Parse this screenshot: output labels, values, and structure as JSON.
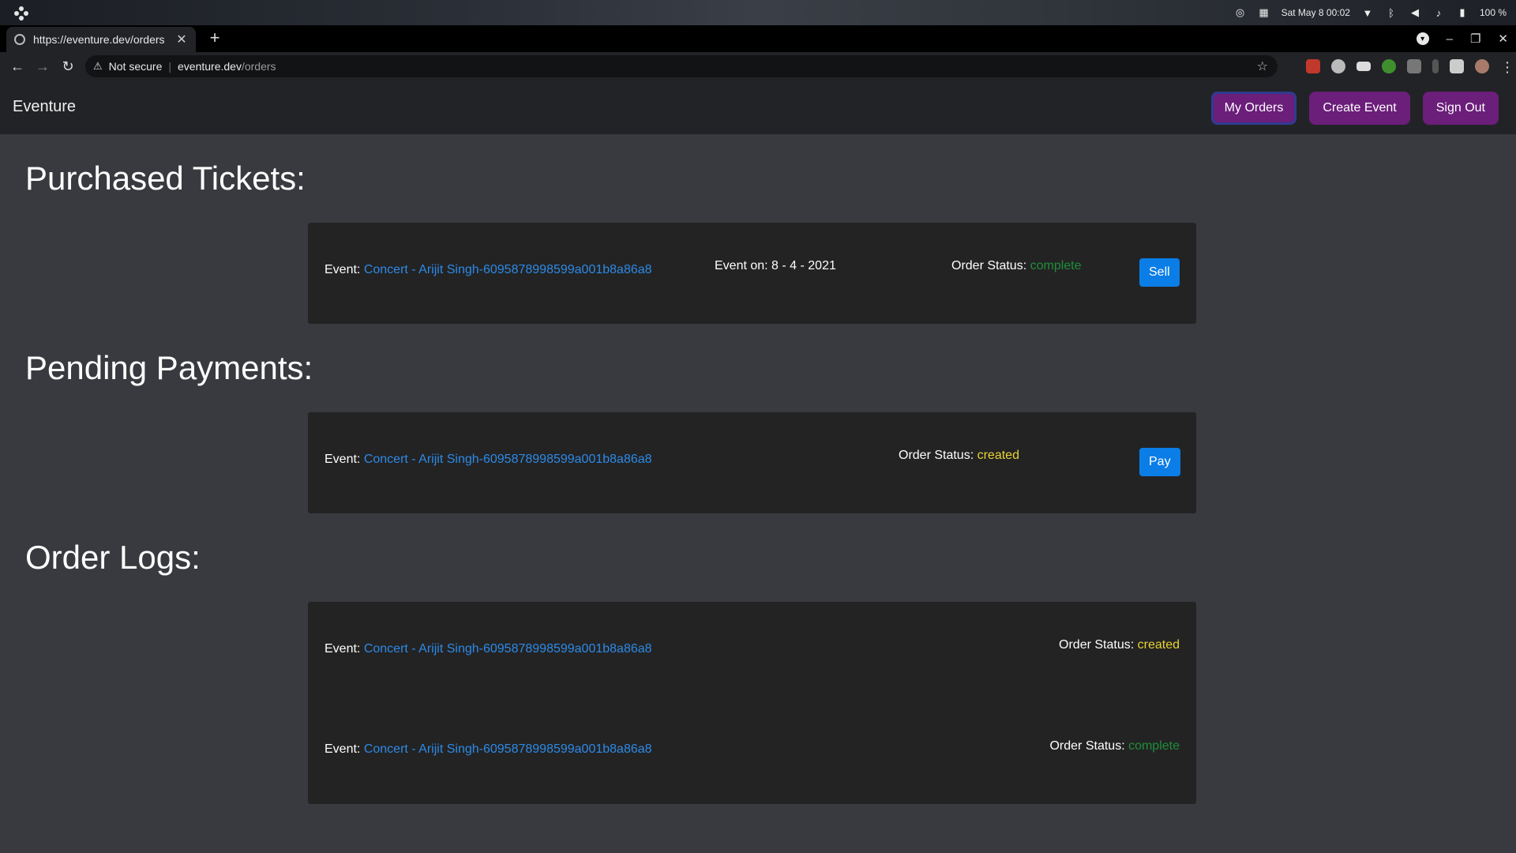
{
  "os": {
    "clock": "Sat May 8  00:02",
    "battery": "100 %"
  },
  "browser": {
    "tab_title": "https://eventure.dev/orders",
    "security_label": "Not secure",
    "url_host": "eventure.dev",
    "url_path": "/orders"
  },
  "app": {
    "brand": "Eventure",
    "nav": {
      "my_orders": "My Orders",
      "create_event": "Create Event",
      "sign_out": "Sign Out"
    }
  },
  "purchased": {
    "title": "Purchased Tickets:",
    "items": [
      {
        "event_label": "Event: ",
        "event_name": "Concert - Arijit Singh-6095878998599a001b8a86a8",
        "date_label": "Event on: 8 - 4 - 2021",
        "status_label": "Order Status: ",
        "status": "complete",
        "action": "Sell"
      }
    ]
  },
  "pending": {
    "title": "Pending Payments:",
    "items": [
      {
        "event_label": "Event: ",
        "event_name": "Concert - Arijit Singh-6095878998599a001b8a86a8",
        "status_label": "Order Status: ",
        "status": "created",
        "action": "Pay"
      }
    ]
  },
  "logs": {
    "title": "Order Logs:",
    "items": [
      {
        "event_label": "Event: ",
        "event_name": "Concert - Arijit Singh-6095878998599a001b8a86a8",
        "status_label": "Order Status: ",
        "status": "created"
      },
      {
        "event_label": "Event: ",
        "event_name": "Concert - Arijit Singh-6095878998599a001b8a86a8",
        "status_label": "Order Status: ",
        "status": "complete"
      }
    ]
  },
  "colors": {
    "nav_button": "#6b1e7a",
    "action_button": "#0b7de6",
    "link": "#2d8ae6",
    "status_complete": "#1f8f3a",
    "status_created": "#e8d432"
  }
}
